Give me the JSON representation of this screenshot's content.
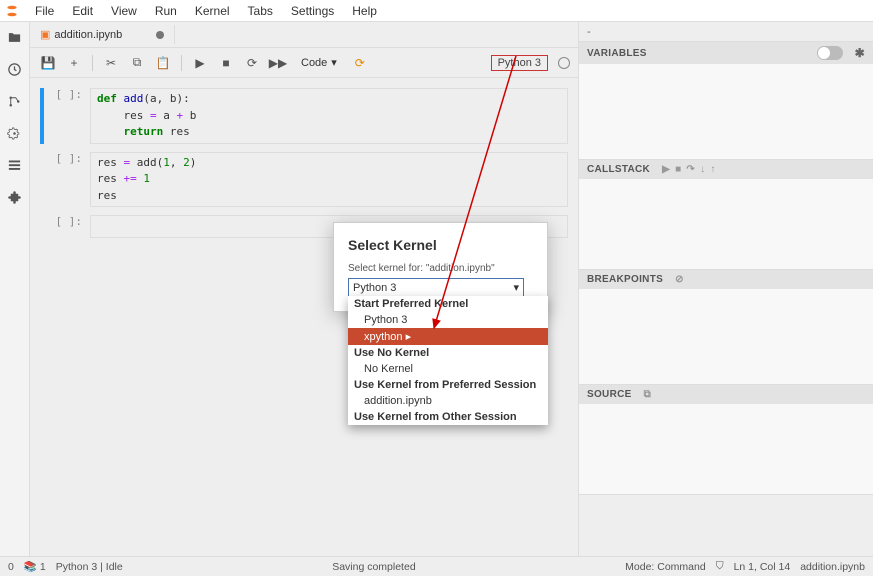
{
  "menu": {
    "items": [
      "File",
      "Edit",
      "View",
      "Run",
      "Kernel",
      "Tabs",
      "Settings",
      "Help"
    ]
  },
  "tab": {
    "filename": "addition.ipynb"
  },
  "toolbar": {
    "celltype": "Code",
    "rewind_glyph": "⟳",
    "kernel": "Python 3"
  },
  "cells": [
    {
      "prompt": "[ ]:",
      "lines": [
        {
          "html": "<span class='kw'>def</span> <span class='fn'>add</span>(a, b):"
        },
        {
          "html": "    res <span class='op'>=</span> a <span class='op'>+</span> b"
        },
        {
          "html": "    <span class='kw'>return</span> res"
        }
      ]
    },
    {
      "prompt": "[ ]:",
      "lines": [
        {
          "html": "res <span class='op'>=</span> add(<span class='num'>1</span>, <span class='num'>2</span>)"
        },
        {
          "html": "res <span class='op'>+=</span> <span class='num'>1</span>"
        },
        {
          "html": "res"
        }
      ]
    },
    {
      "prompt": "[ ]:",
      "lines": [
        {
          "html": " "
        }
      ]
    }
  ],
  "rightpanel": {
    "dash": "-",
    "variables": "VARIABLES",
    "callstack": "CALLSTACK",
    "breakpoints": "BREAKPOINTS",
    "source": "SOURCE"
  },
  "dialog": {
    "title": "Select Kernel",
    "subtitle": "Select kernel for: \"addition.ipynb\"",
    "selected": "Python 3",
    "groups": [
      {
        "label": "Start Preferred Kernel",
        "items": [
          "Python 3",
          "xpython"
        ]
      },
      {
        "label": "Use No Kernel",
        "items": [
          "No Kernel"
        ]
      },
      {
        "label": "Use Kernel from Preferred Session",
        "items": [
          "addition.ipynb"
        ]
      },
      {
        "label": "Use Kernel from Other Session",
        "items": []
      }
    ],
    "highlighted": "xpython"
  },
  "statusbar": {
    "zero": "0",
    "one": "1",
    "kernel_status": "Python 3 | Idle",
    "saving": "Saving completed",
    "mode": "Mode: Command",
    "position": "Ln 1, Col 14",
    "file": "addition.ipynb"
  }
}
